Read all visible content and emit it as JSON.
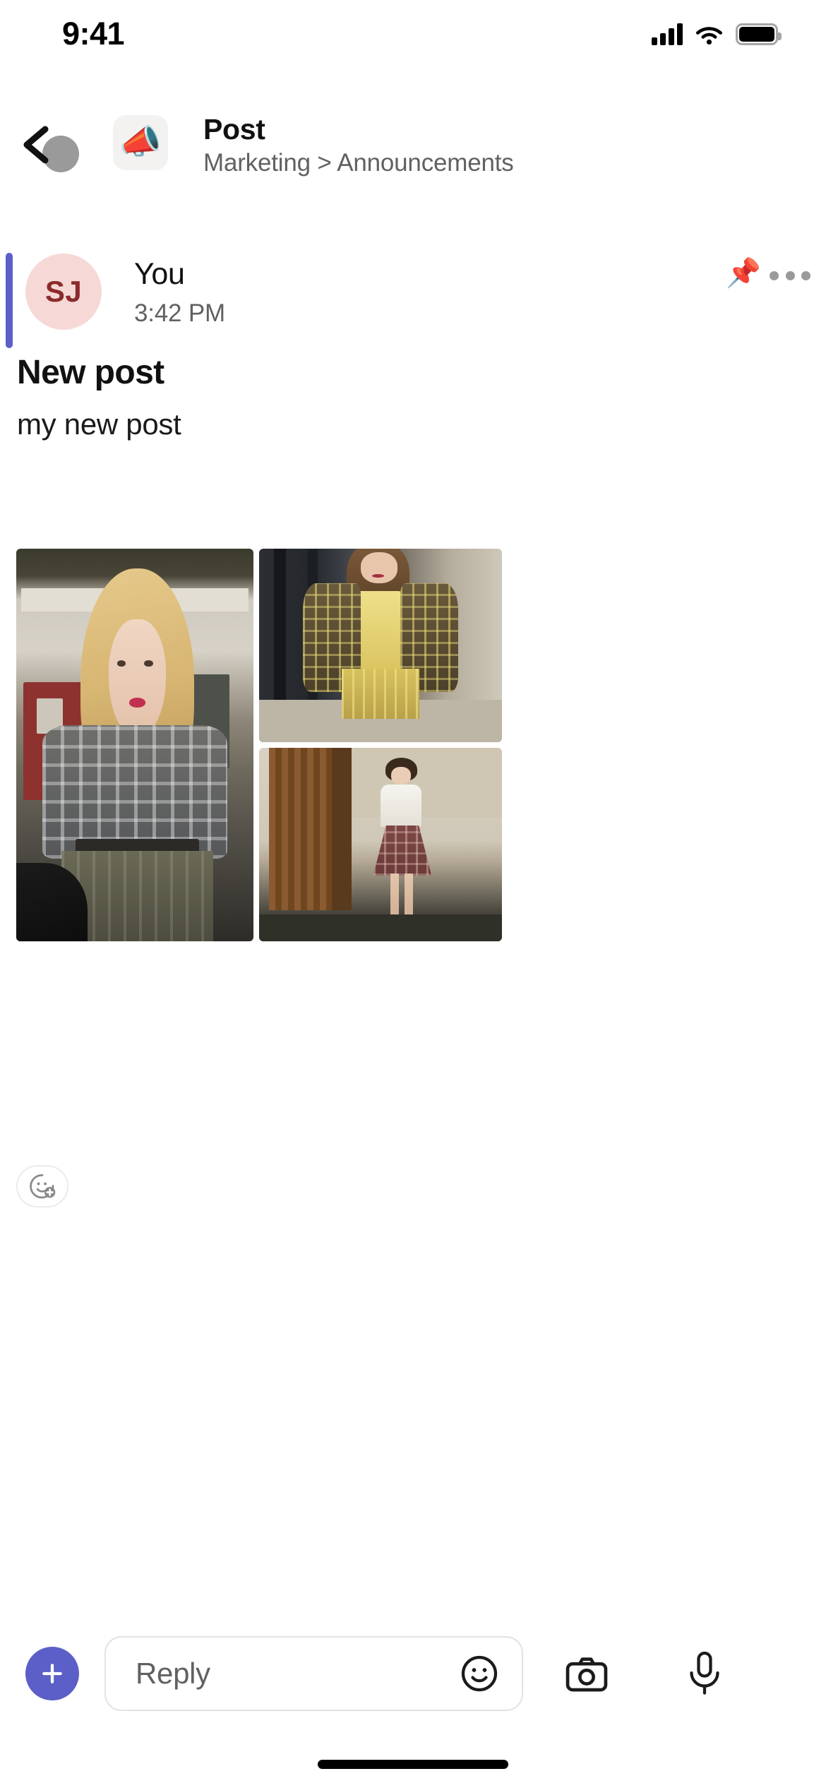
{
  "status_bar": {
    "time": "9:41",
    "cellular_icon": "signal-bars-icon",
    "wifi_icon": "wifi-icon",
    "battery_icon": "battery-full-icon"
  },
  "nav": {
    "back_icon": "back-chevron-icon",
    "avatar_icon": "user-avatar-icon",
    "channel_icon": "megaphone-icon",
    "channel_emoji": "📣",
    "title": "Post",
    "breadcrumb": "Marketing > Announcements"
  },
  "post": {
    "accent_color": "#5b5fc7",
    "avatar_initials": "SJ",
    "avatar_bg": "#f6d9d7",
    "avatar_fg": "#8c2b2b",
    "author": "You",
    "timestamp": "3:42 PM",
    "pinned_icon": "pin-icon",
    "pinned_emoji": "📌",
    "more_icon": "more-options-icon",
    "title": "New post",
    "body": "my new post",
    "attachments": [
      {
        "name": "photo-blonde-woman-plaid-shirt"
      },
      {
        "name": "photo-yellow-plaid-suit"
      },
      {
        "name": "photo-white-top-burgundy-skirt"
      }
    ],
    "add_reaction_icon": "add-reaction-icon"
  },
  "reply_bar": {
    "add_icon": "plus-icon",
    "placeholder": "Reply",
    "emoji_icon": "emoji-smiley-icon",
    "camera_icon": "camera-icon",
    "microphone_icon": "microphone-icon"
  },
  "system": {
    "home_indicator": "home-indicator"
  }
}
